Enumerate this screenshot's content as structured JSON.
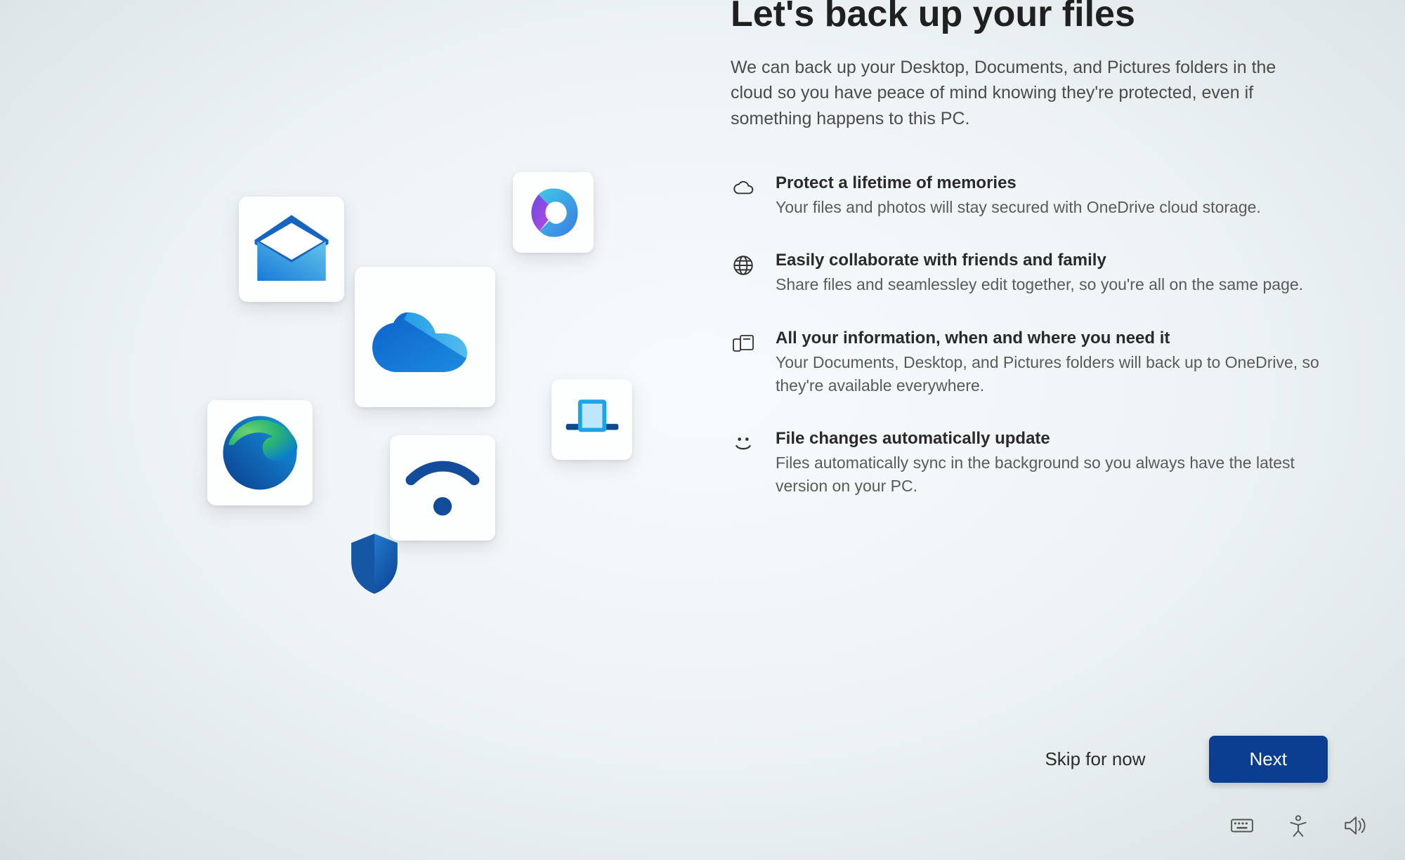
{
  "title": "Let's back up your files",
  "subtitle": "We can back up your Desktop, Documents, and Pictures folders in the cloud so you have peace of mind knowing they're protected, even if something happens to this PC.",
  "features": [
    {
      "icon": "cloud-icon",
      "heading": "Protect a lifetime of memories",
      "desc": "Your files and photos will stay secured with OneDrive cloud storage."
    },
    {
      "icon": "globe-icon",
      "heading": "Easily collaborate with friends and family",
      "desc": "Share files and seamlessley edit together, so you're all on the same page."
    },
    {
      "icon": "devices-icon",
      "heading": "All your information, when and where you need it",
      "desc": "Your Documents, Desktop, and Pictures folders will back up to OneDrive, so they're available everywhere."
    },
    {
      "icon": "smile-icon",
      "heading": "File changes automatically update",
      "desc": "Files automatically sync in the background so you always have the latest version on your PC."
    }
  ],
  "actions": {
    "skip": "Skip for now",
    "next": "Next"
  },
  "illustration_tiles": [
    "mail-app-icon",
    "office-app-icon",
    "onedrive-app-icon",
    "edge-app-icon",
    "security-app-icon",
    "wifi-icon",
    "your-phone-app-icon"
  ],
  "tray": {
    "keyboard": "input-keyboard-icon",
    "accessibility": "accessibility-icon",
    "volume": "volume-icon"
  },
  "colors": {
    "primary_button": "#0b3e91",
    "text": "#2b2b2b",
    "muted": "#5a5a5a"
  }
}
